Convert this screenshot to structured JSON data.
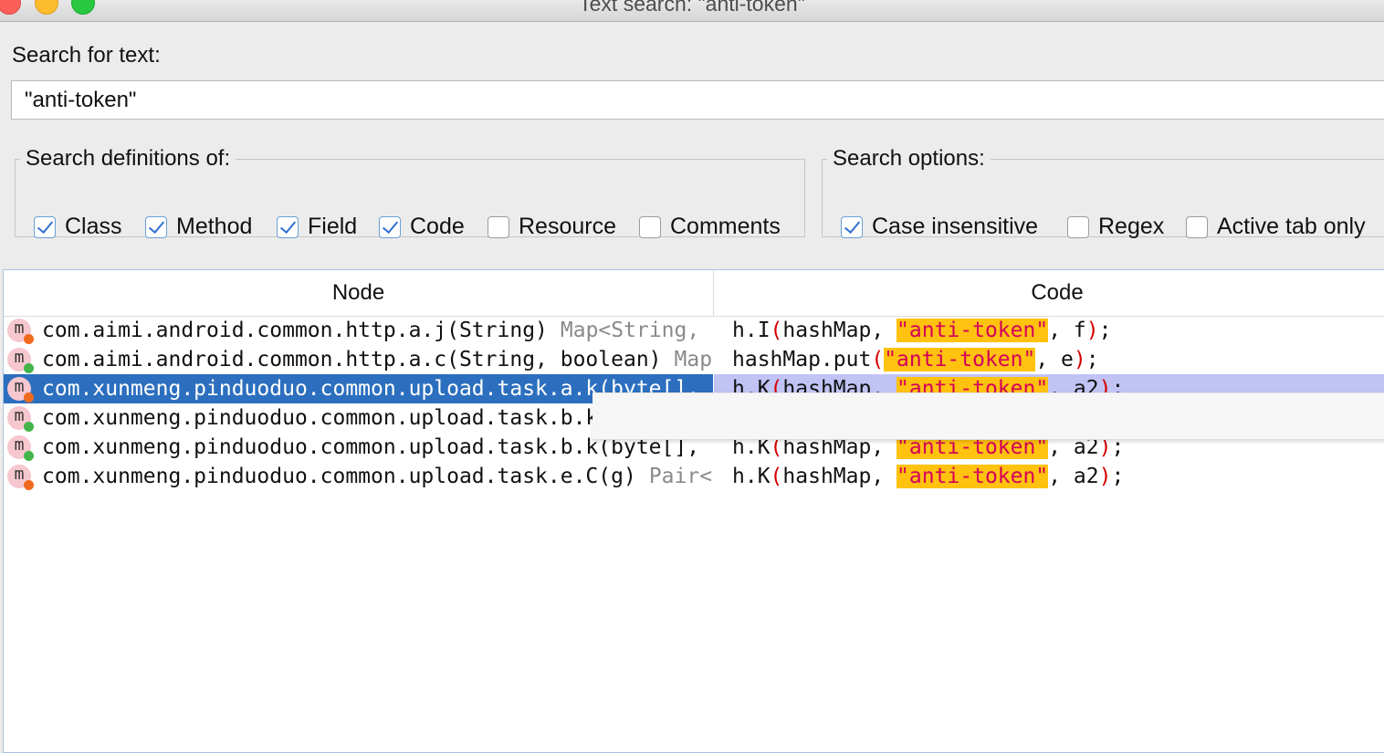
{
  "window": {
    "title": "Text search: \"anti-token\""
  },
  "search": {
    "label": "Search for text:",
    "value": "\"anti-token\""
  },
  "definitions": {
    "legend": "Search definitions of:",
    "options": [
      {
        "label": "Class",
        "checked": true
      },
      {
        "label": "Method",
        "checked": true
      },
      {
        "label": "Field",
        "checked": true
      },
      {
        "label": "Code",
        "checked": true
      },
      {
        "label": "Resource",
        "checked": false
      },
      {
        "label": "Comments",
        "checked": false
      }
    ]
  },
  "options": {
    "legend": "Search options:",
    "items": [
      {
        "label": "Case insensitive",
        "checked": true
      },
      {
        "label": "Regex",
        "checked": false
      },
      {
        "label": "Active tab only",
        "checked": false
      }
    ]
  },
  "results": {
    "columns": [
      "Node",
      "Code"
    ],
    "rows": [
      {
        "icon": "method-icon",
        "status": "orange",
        "node": "com.aimi.android.common.http.a.j(String)",
        "signature": "Map<String,",
        "code_prefix": "h.I",
        "code_args_before": "hashMap, ",
        "code_match": "\"anti-token\"",
        "code_args_after": ", f",
        "selected": false
      },
      {
        "icon": "method-icon",
        "status": "green",
        "node": "com.aimi.android.common.http.a.c(String, boolean)",
        "signature": "Map",
        "code_prefix": "hashMap.put",
        "code_args_before": "",
        "code_match": "\"anti-token\"",
        "code_args_after": ", e",
        "selected": false
      },
      {
        "icon": "method-icon",
        "status": "orange",
        "node": "com.xunmeng.pinduoduo.common.upload.task.a.k(byte[],",
        "signature": "",
        "code_prefix": "h.K",
        "code_args_before": "hashMap, ",
        "code_match": "\"anti-token\"",
        "code_args_after": ", a2",
        "selected": true
      },
      {
        "icon": "method-icon",
        "status": "green",
        "node": "com.xunmeng.pinduoduo.common.upload.task.b.k",
        "signature": "",
        "code_prefix": "",
        "code_args_before": "",
        "code_match": "",
        "code_args_after": "",
        "selected": false
      },
      {
        "icon": "method-icon",
        "status": "green",
        "node": "com.xunmeng.pinduoduo.common.upload.task.b.k(byte[],",
        "signature": "",
        "code_prefix": "h.K",
        "code_args_before": "hashMap, ",
        "code_match": "\"anti-token\"",
        "code_args_after": ", a2",
        "selected": false
      },
      {
        "icon": "method-icon",
        "status": "orange",
        "node": "com.xunmeng.pinduoduo.common.upload.task.e.C(g)",
        "signature": "Pair<",
        "code_prefix": "h.K",
        "code_args_before": "hashMap, ",
        "code_match": "\"anti-token\"",
        "code_args_after": ", a2",
        "selected": false
      }
    ]
  },
  "colors": {
    "selection": "#2c6fbe",
    "match_highlight": "#ffc20e",
    "match_text": "#d4005a"
  }
}
